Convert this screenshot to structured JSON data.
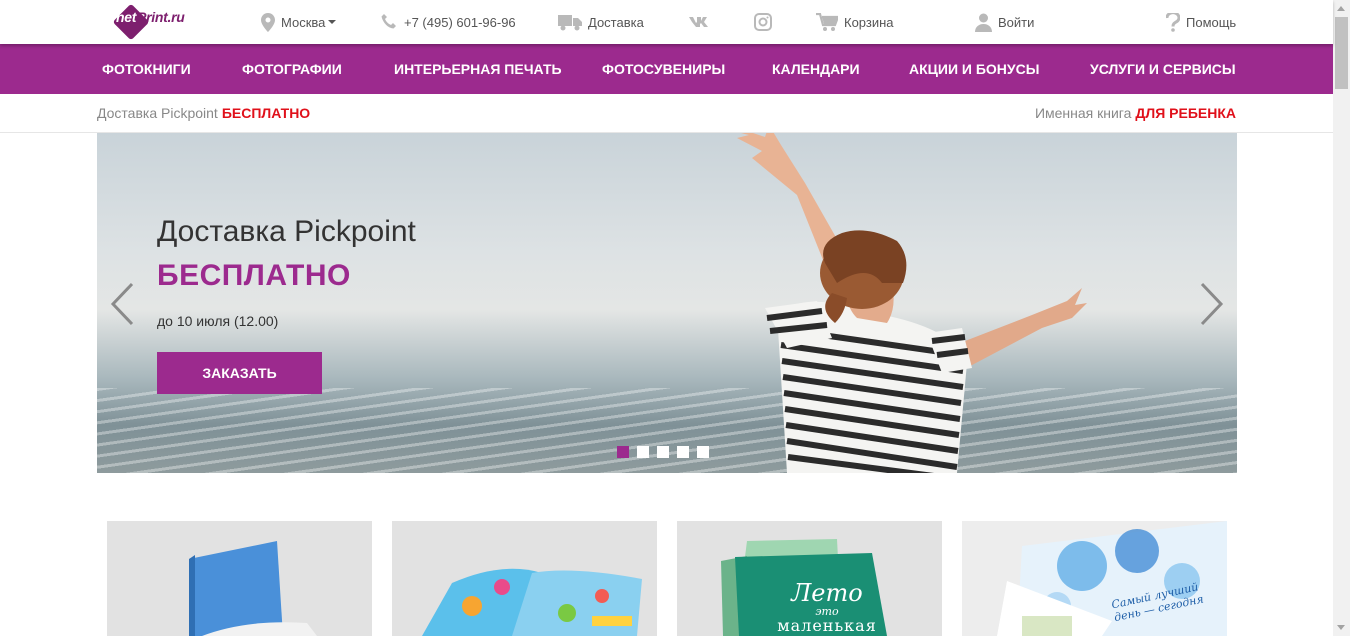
{
  "topbar": {
    "logo": {
      "net": "net",
      "print": "Print.ru"
    },
    "city": "Москва",
    "phone": "+7 (495) 601-96-96",
    "delivery": "Доставка",
    "cart": "Корзина",
    "login": "Войти",
    "help": "Помощь"
  },
  "nav": [
    {
      "label": "ФОТОКНИГИ"
    },
    {
      "label": "ФОТОГРАФИИ"
    },
    {
      "label": "ИНТЕРЬЕРНАЯ ПЕЧАТЬ"
    },
    {
      "label": "ФОТОСУВЕНИРЫ"
    },
    {
      "label": "КАЛЕНДАРИ"
    },
    {
      "label": "АКЦИИ И БОНУСЫ"
    },
    {
      "label": "УСЛУГИ И СЕРВИСЫ"
    }
  ],
  "promos": {
    "left": {
      "text": "Доставка Pickpoint",
      "highlight": "БЕСПЛАТНО"
    },
    "right": {
      "text": "Именная книга",
      "highlight": "ДЛЯ РЕБЕНКА"
    }
  },
  "hero": {
    "title": "Доставка Pickpoint",
    "subtitle": "БЕСПЛАТНО",
    "note": "до 10 июля (12.00)",
    "button": "ЗАКАЗАТЬ",
    "slides_total": 5,
    "active_slide": 1
  },
  "cards": {
    "card3_text_line1": "Лето",
    "card3_text_line2": "это",
    "card3_text_line3": "маленькая",
    "card4_text": "Самый лучший день — сегодня"
  },
  "colors": {
    "brand": "#9c2a8e",
    "accent_red": "#e0101a",
    "logo": "#7d1f6e"
  },
  "icons": [
    "location-icon",
    "phone-icon",
    "truck-icon",
    "vk-icon",
    "instagram-icon",
    "cart-icon",
    "user-icon",
    "question-icon"
  ]
}
